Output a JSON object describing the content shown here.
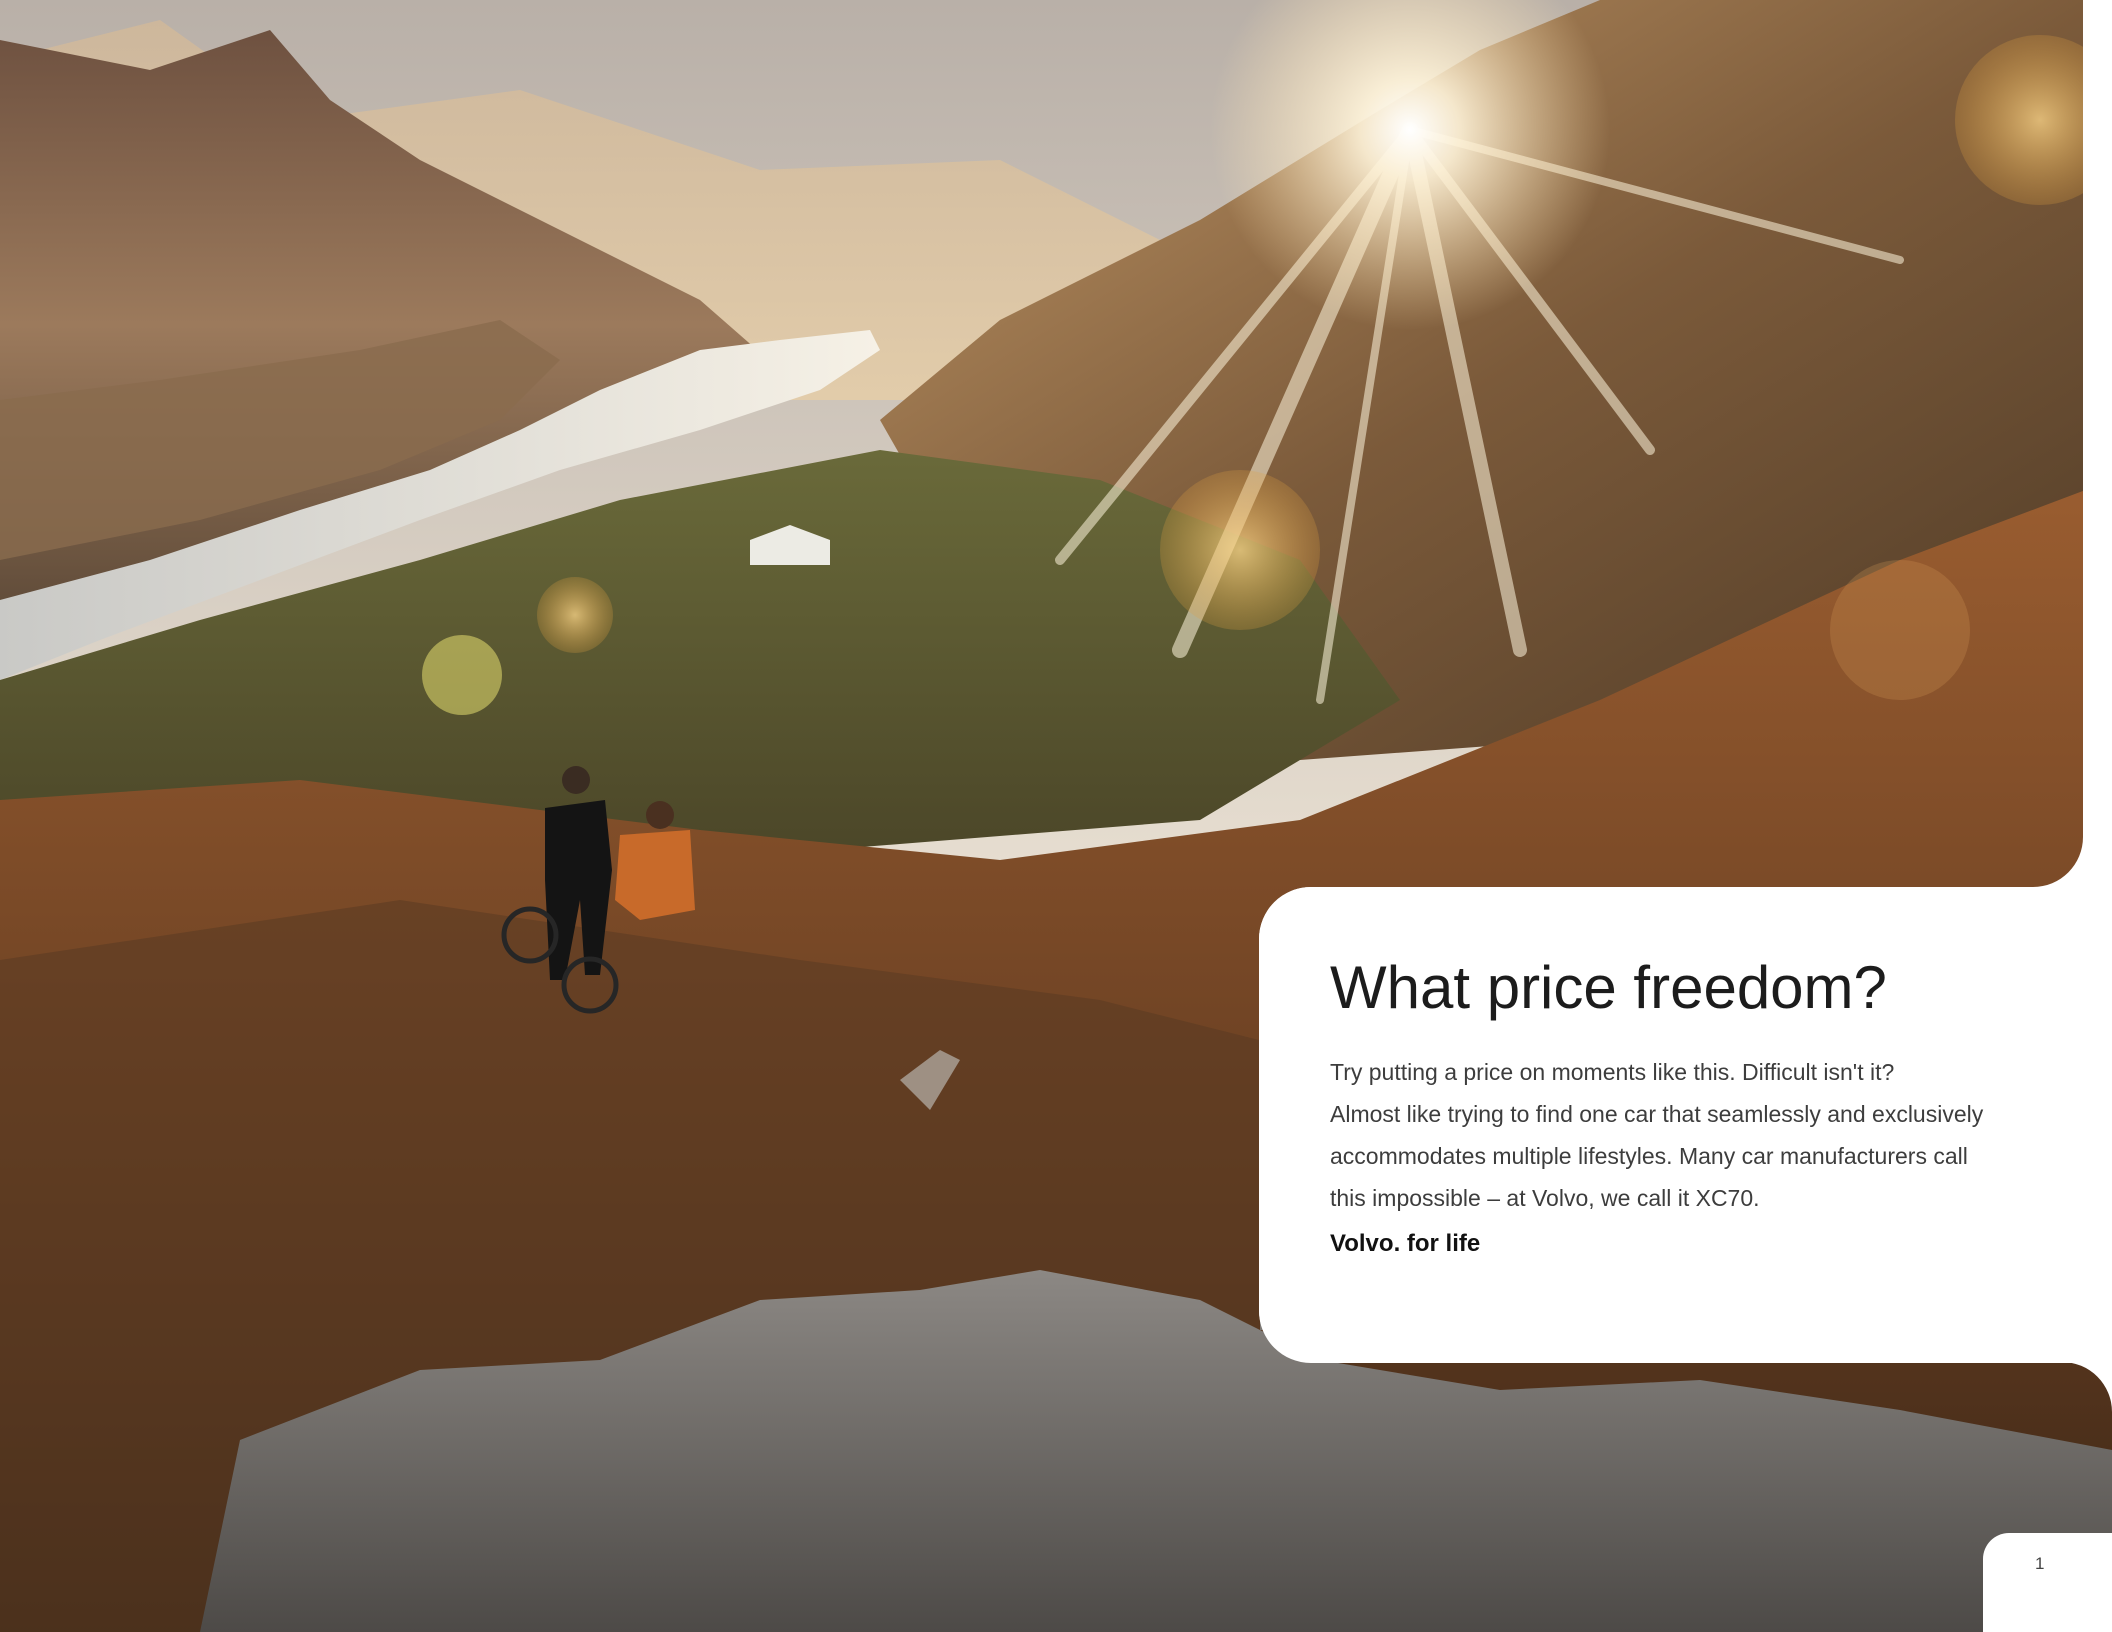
{
  "colors": {
    "accent": "#d9a45a",
    "text": "#1c1c1c",
    "panel": "#ffffff"
  },
  "article": {
    "heading": "What price freedom?",
    "lines": [
      "Try putting a price on moments like this. Difficult isn't it?",
      "Almost like trying to find one car that seamlessly and exclusively",
      "accommodates multiple lifestyles. Many car manufacturers call",
      "this impossible – at Volvo, we call it XC70."
    ],
    "tagline": "Volvo. for life"
  },
  "page": {
    "number": "1"
  }
}
